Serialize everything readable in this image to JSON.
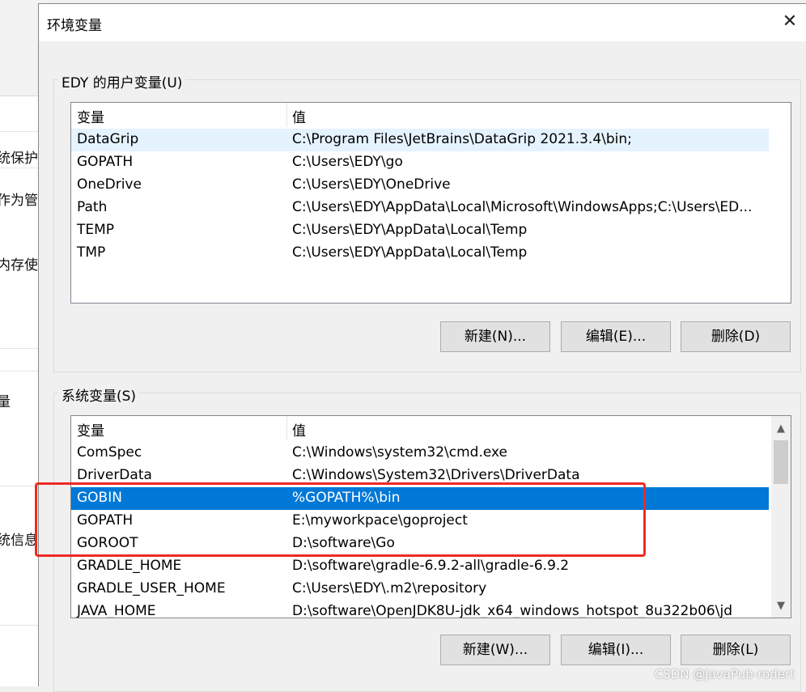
{
  "background_window": {
    "items": [
      "统保护",
      "作为管",
      "内存使用",
      "量",
      "统信息"
    ]
  },
  "dialog": {
    "title": "环境变量",
    "close_symbol": "✕"
  },
  "user_vars": {
    "group_label": "EDY 的用户变量(U)",
    "columns": [
      "变量",
      "值"
    ],
    "rows": [
      {
        "name": "DataGrip",
        "value": "C:\\Program Files\\JetBrains\\DataGrip 2021.3.4\\bin;"
      },
      {
        "name": "GOPATH",
        "value": "C:\\Users\\EDY\\go"
      },
      {
        "name": "OneDrive",
        "value": "C:\\Users\\EDY\\OneDrive"
      },
      {
        "name": "Path",
        "value": "C:\\Users\\EDY\\AppData\\Local\\Microsoft\\WindowsApps;C:\\Users\\ED..."
      },
      {
        "name": "TEMP",
        "value": "C:\\Users\\EDY\\AppData\\Local\\Temp"
      },
      {
        "name": "TMP",
        "value": "C:\\Users\\EDY\\AppData\\Local\\Temp"
      }
    ],
    "buttons": {
      "new": "新建(N)...",
      "edit": "编辑(E)...",
      "delete": "删除(D)"
    }
  },
  "system_vars": {
    "group_label": "系统变量(S)",
    "columns": [
      "变量",
      "值"
    ],
    "rows": [
      {
        "name": "ComSpec",
        "value": "C:\\Windows\\system32\\cmd.exe"
      },
      {
        "name": "DriverData",
        "value": "C:\\Windows\\System32\\Drivers\\DriverData"
      },
      {
        "name": "GOBIN",
        "value": "%GOPATH%\\bin"
      },
      {
        "name": "GOPATH",
        "value": "E:\\myworkpace\\goproject"
      },
      {
        "name": "GOROOT",
        "value": "D:\\software\\Go"
      },
      {
        "name": "GRADLE_HOME",
        "value": "D:\\software\\gradle-6.9.2-all\\gradle-6.9.2"
      },
      {
        "name": "GRADLE_USER_HOME",
        "value": "C:\\Users\\EDY\\.m2\\repository"
      },
      {
        "name": "JAVA_HOME",
        "value": "D:\\software\\OpenJDK8U-jdk_x64_windows_hotspot_8u322b06\\jd"
      }
    ],
    "buttons": {
      "new": "新建(W)...",
      "edit": "编辑(I)...",
      "delete": "删除(L)"
    },
    "scroll_up": "▲",
    "scroll_down": "▼"
  },
  "colors": {
    "selection": "#0078d7",
    "annotation": "#ee2a24"
  },
  "watermark": "CSDN @JavaPub-rodert"
}
